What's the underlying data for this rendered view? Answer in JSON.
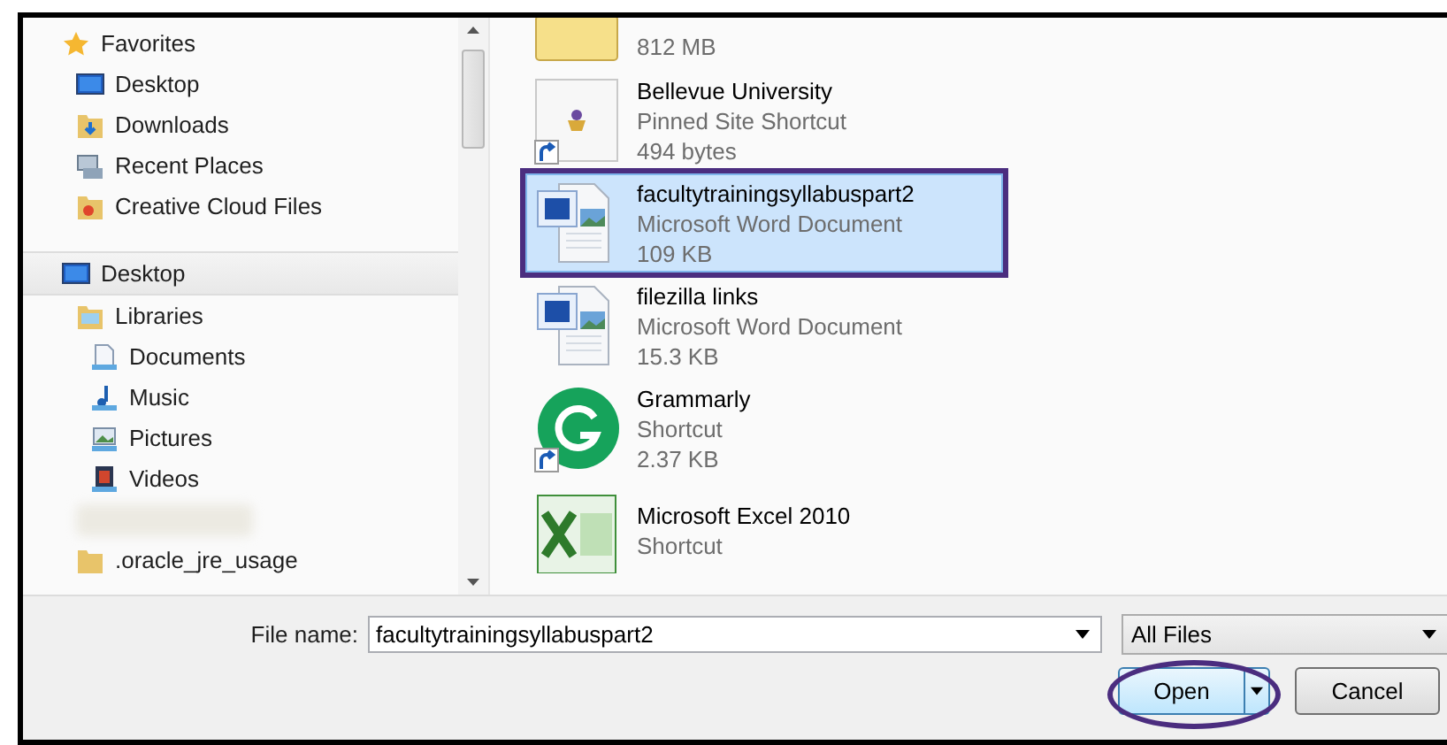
{
  "navigation": [
    {
      "label": "Favorites",
      "kind": "star",
      "selected": false,
      "children": [
        {
          "label": "Desktop",
          "kind": "desktop",
          "selected": false
        },
        {
          "label": "Downloads",
          "kind": "downloads",
          "selected": false
        },
        {
          "label": "Recent Places",
          "kind": "recent",
          "selected": false
        },
        {
          "label": "Creative Cloud Files",
          "kind": "cloudfolder",
          "selected": false
        }
      ]
    },
    {
      "label": "Desktop",
      "kind": "desktop",
      "selected": true,
      "children": [
        {
          "label": "Libraries",
          "kind": "libraries",
          "selected": false,
          "children": [
            {
              "label": "Documents",
              "kind": "documents",
              "selected": false
            },
            {
              "label": "Music",
              "kind": "music",
              "selected": false
            },
            {
              "label": "Pictures",
              "kind": "pictures",
              "selected": false
            },
            {
              "label": "Videos",
              "kind": "videos",
              "selected": false
            }
          ]
        },
        {
          "kind": "redacted"
        },
        {
          "label": ".oracle_jre_usage",
          "kind": "folder",
          "selected": false
        }
      ]
    }
  ],
  "files": [
    {
      "kind": "zip",
      "size": "812 MB",
      "selected": false
    },
    {
      "kind": "site",
      "name": "Bellevue University",
      "type": "Pinned Site Shortcut",
      "size": "494 bytes",
      "selected": false
    },
    {
      "kind": "word",
      "name": "facultytrainingsyllabuspart2",
      "type": "Microsoft Word Document",
      "size": "109 KB",
      "selected": true
    },
    {
      "kind": "word",
      "name": "filezilla links",
      "type": "Microsoft Word Document",
      "size": "15.3 KB",
      "selected": false
    },
    {
      "kind": "grammarly",
      "name": "Grammarly",
      "type": "Shortcut",
      "size": "2.37 KB",
      "selected": false
    },
    {
      "kind": "excel",
      "name": "Microsoft Excel 2010",
      "type": "Shortcut",
      "selected": false
    }
  ],
  "file_name": {
    "label": "File name:",
    "value": "facultytrainingsyllabuspart2"
  },
  "file_type": {
    "value": "All Files"
  },
  "open_button": {
    "label": "Open",
    "circled": true
  },
  "cancel_button": {
    "label": "Cancel"
  }
}
